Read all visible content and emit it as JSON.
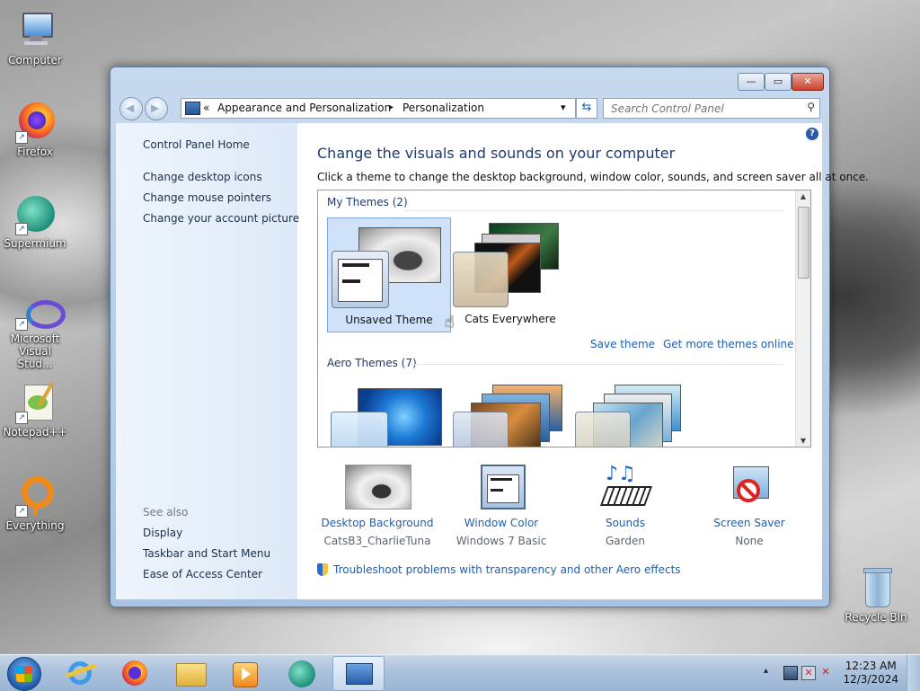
{
  "desktop": {
    "icons": [
      {
        "label": "Computer"
      },
      {
        "label": "Firefox"
      },
      {
        "label": "Supermium"
      },
      {
        "label": "Microsoft Visual Stud..."
      },
      {
        "label": "Notepad++"
      },
      {
        "label": "Everything"
      },
      {
        "label": "Recycle Bin"
      }
    ]
  },
  "window": {
    "controls": {
      "minimize": "—",
      "maximize": "▭",
      "close": "✕"
    },
    "address": {
      "prefix": "«",
      "crumb1": "Appearance and Personalization",
      "separator": "▸",
      "crumb2": "Personalization",
      "dropdown": "▾"
    },
    "search": {
      "placeholder": "Search Control Panel"
    },
    "help": "?"
  },
  "sidebar": {
    "home": "Control Panel Home",
    "links": [
      "Change desktop icons",
      "Change mouse pointers",
      "Change your account picture"
    ],
    "see_also_title": "See also",
    "see_also": [
      "Display",
      "Taskbar and Start Menu",
      "Ease of Access Center"
    ]
  },
  "main": {
    "heading": "Change the visuals and sounds on your computer",
    "subtext": "Click a theme to change the desktop background, window color, sounds, and screen saver all at once.",
    "my_themes_label": "My Themes (2)",
    "themes": [
      {
        "name": "Unsaved Theme",
        "selected": true
      },
      {
        "name": "Cats Everywhere",
        "selected": false
      }
    ],
    "save_theme": "Save theme",
    "get_more": "Get more themes online",
    "aero_themes_label": "Aero Themes (7)"
  },
  "bottom": [
    {
      "label": "Desktop Background",
      "value": "CatsB3_CharlieTuna"
    },
    {
      "label": "Window Color",
      "value": "Windows 7 Basic"
    },
    {
      "label": "Sounds",
      "value": "Garden"
    },
    {
      "label": "Screen Saver",
      "value": "None"
    }
  ],
  "troubleshoot": "Troubleshoot problems with transparency and other Aero effects",
  "taskbar": {
    "clock_time": "12:23 AM",
    "clock_date": "12/3/2024",
    "tray_arrow": "▴"
  },
  "colors": {
    "link": "#1a5fb4",
    "heading": "#1e3a6e",
    "selection": "#cfe2fa"
  }
}
